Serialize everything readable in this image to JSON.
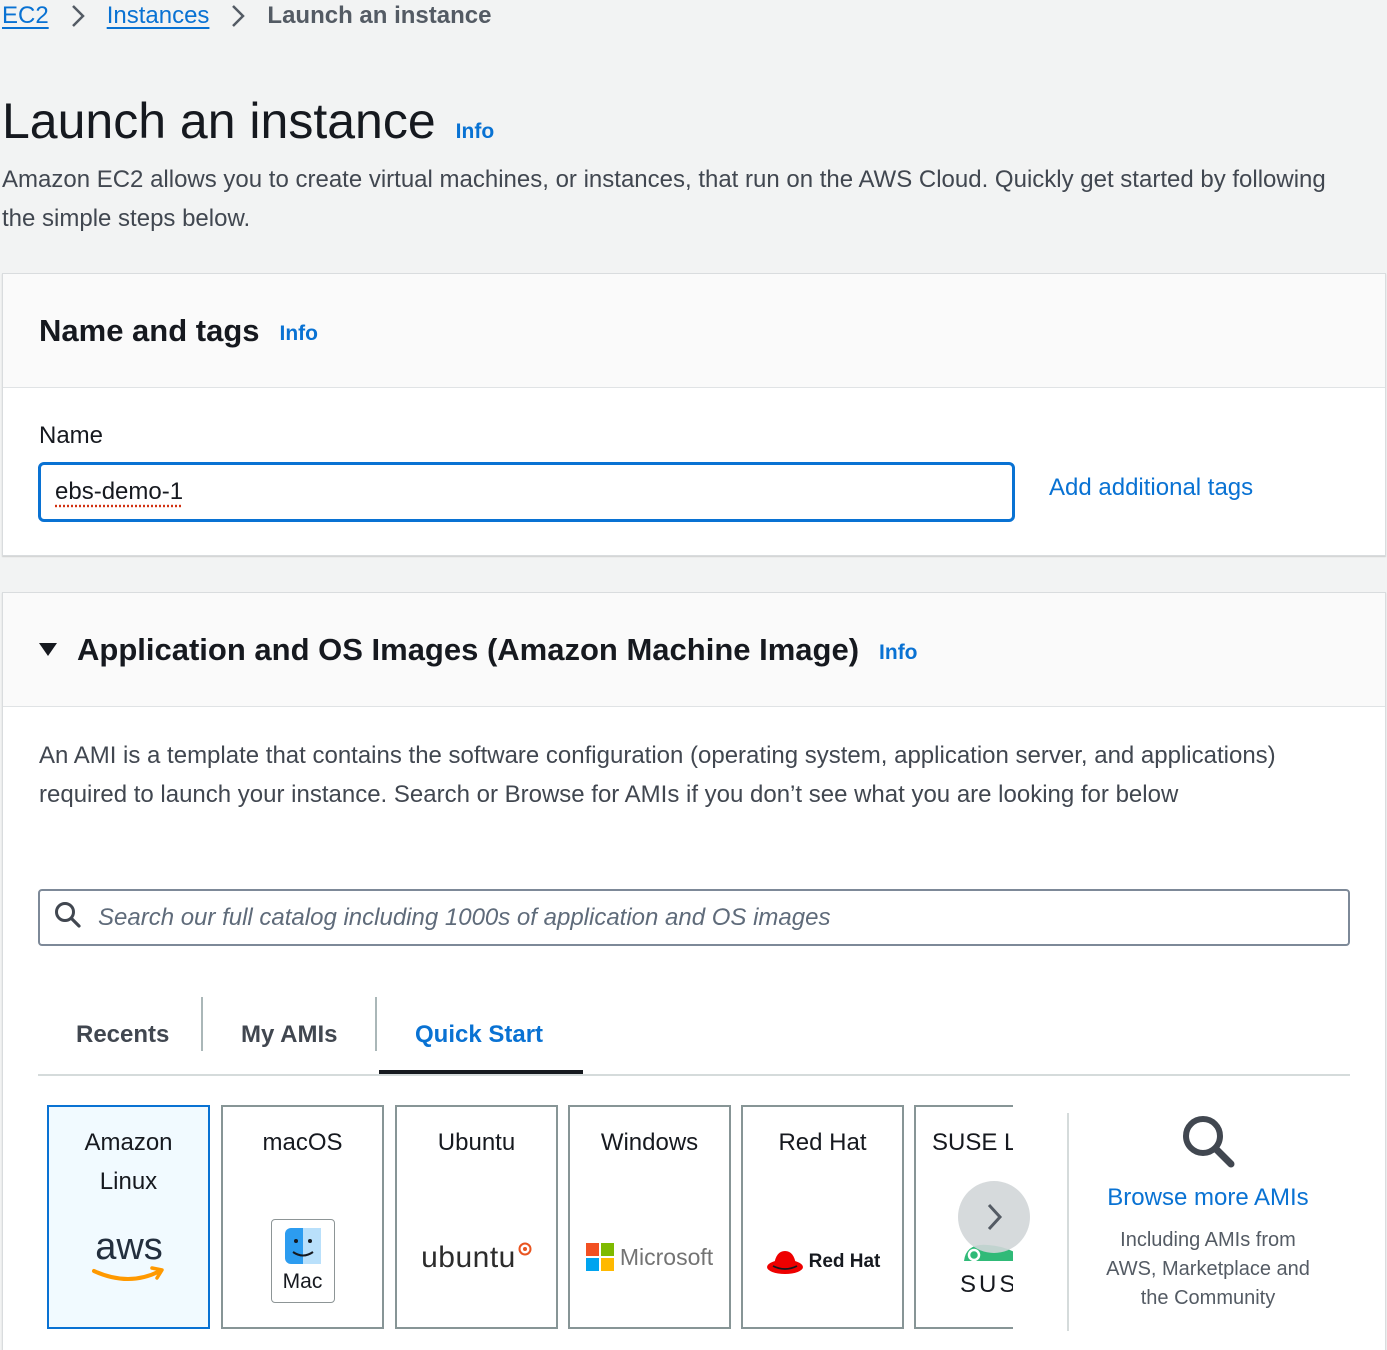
{
  "breadcrumb": {
    "items": [
      "EC2",
      "Instances"
    ],
    "current": "Launch an instance"
  },
  "page": {
    "title": "Launch an instance",
    "info": "Info",
    "description": "Amazon EC2 allows you to create virtual machines, or instances, that run on the AWS Cloud. Quickly get started by following the simple steps below."
  },
  "name_tags": {
    "title": "Name and tags",
    "info": "Info",
    "name_label": "Name",
    "name_value": "ebs-demo-1",
    "add_tags": "Add additional tags"
  },
  "ami": {
    "title": "Application and OS Images (Amazon Machine Image)",
    "info": "Info",
    "description": "An AMI is a template that contains the software configuration (operating system, application server, and applications) required to launch your instance. Search or Browse for AMIs if you don’t see what you are looking for below",
    "search_placeholder": "Search our full catalog including 1000s of application and OS images",
    "tabs": [
      "Recents",
      "My AMIs",
      "Quick Start"
    ],
    "active_tab": "Quick Start",
    "cards": [
      {
        "label_lines": [
          "Amazon",
          "Linux"
        ],
        "logo_text": "aws",
        "selected": true
      },
      {
        "label_lines": [
          "macOS"
        ],
        "logo_text": "Mac"
      },
      {
        "label_lines": [
          "Ubuntu"
        ],
        "logo_text": "ubuntu"
      },
      {
        "label_lines": [
          "Windows"
        ],
        "logo_text": "Microsoft"
      },
      {
        "label_lines": [
          "Red Hat"
        ],
        "logo_text": "Red Hat"
      },
      {
        "label_lines": [
          "SUSE Li"
        ],
        "logo_text": "SUS"
      }
    ],
    "browse": {
      "link": "Browse more AMIs",
      "sub_lines": [
        "Including AMIs from",
        "AWS, Marketplace and",
        "the Community"
      ]
    }
  },
  "colors": {
    "link": "#0972d3",
    "selected_bg": "#f1faff",
    "aws_orange": "#ff9900",
    "ubuntu": "#e95420",
    "redhat": "#ee0000"
  }
}
